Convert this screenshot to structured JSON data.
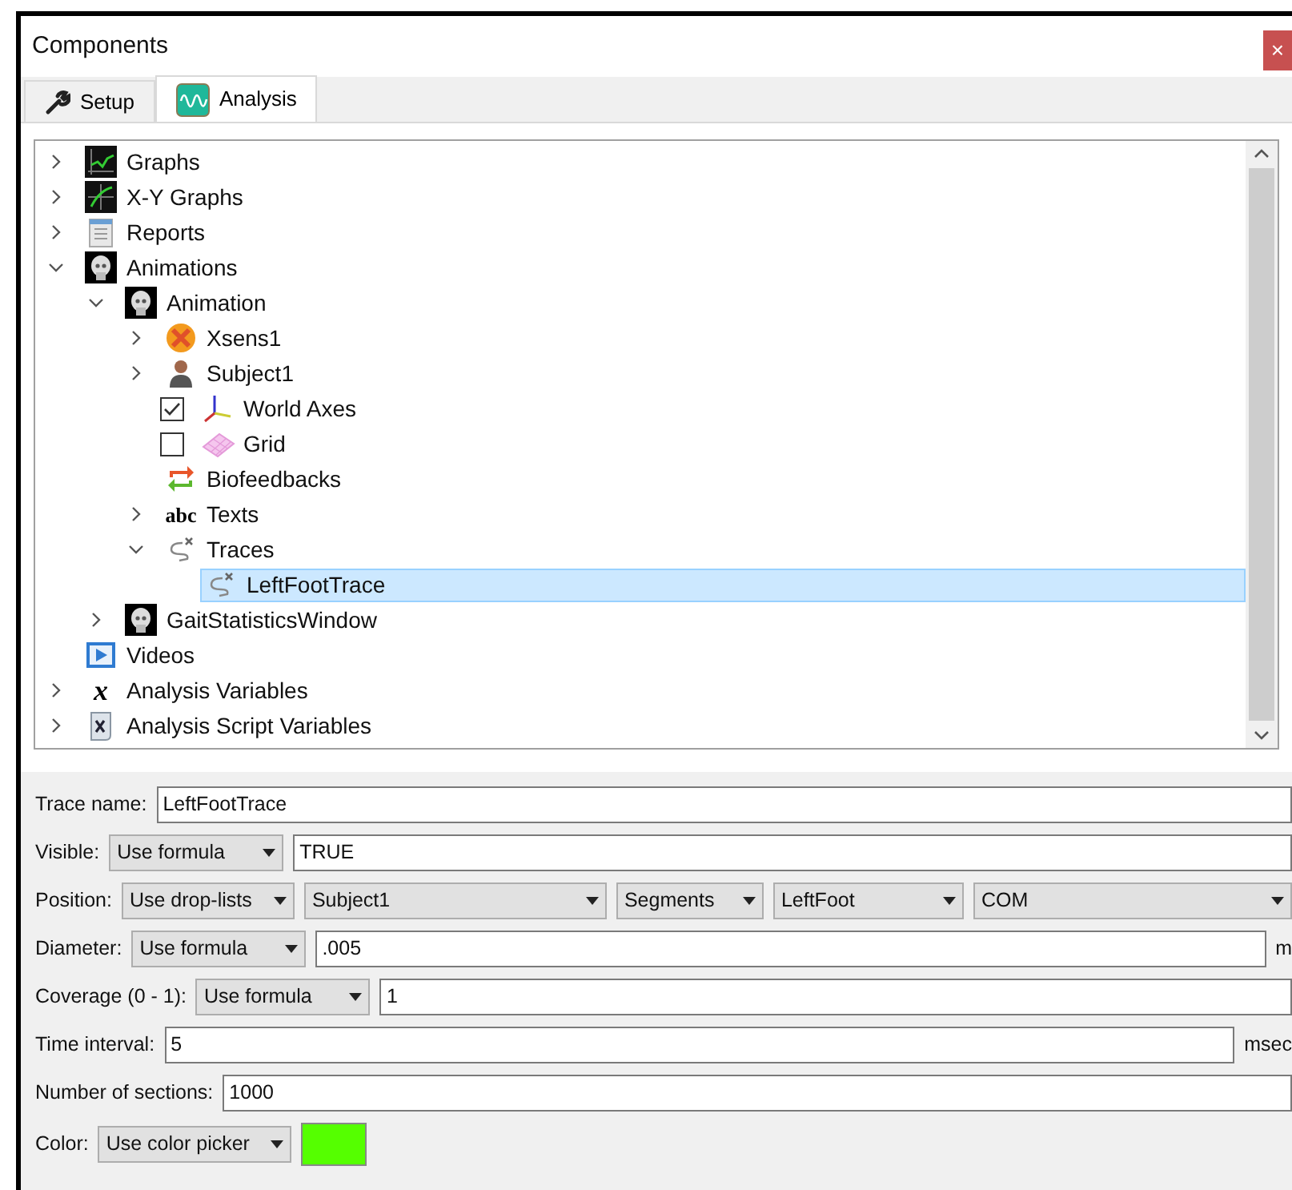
{
  "window": {
    "title": "Components",
    "close": "×"
  },
  "tabs": [
    {
      "label": "Setup",
      "selected": false
    },
    {
      "label": "Analysis",
      "selected": true
    }
  ],
  "tree": {
    "items": [
      {
        "label": "Graphs",
        "kind": "graph",
        "expanded": false,
        "selected": false
      },
      {
        "label": "X-Y Graphs",
        "kind": "xy-graph",
        "expanded": false,
        "selected": false
      },
      {
        "label": "Reports",
        "kind": "report",
        "expanded": false,
        "selected": false
      },
      {
        "label": "Animations",
        "kind": "skull",
        "expanded": true,
        "selected": false,
        "children": [
          {
            "label": "Animation",
            "kind": "skull",
            "expanded": true,
            "selected": false,
            "children": [
              {
                "label": "Xsens1",
                "kind": "xsens",
                "expanded": false,
                "selected": false
              },
              {
                "label": "Subject1",
                "kind": "person",
                "expanded": false,
                "selected": false
              },
              {
                "label": "World Axes",
                "kind": "axes",
                "checked": true,
                "selected": false
              },
              {
                "label": "Grid",
                "kind": "grid",
                "checked": false,
                "selected": false
              },
              {
                "label": "Biofeedbacks",
                "kind": "biofeedback",
                "selected": false
              },
              {
                "label": "Texts",
                "kind": "text",
                "icon_text": "abc",
                "expanded": false,
                "selected": false
              },
              {
                "label": "Traces",
                "kind": "trace",
                "expanded": true,
                "selected": false,
                "children": [
                  {
                    "label": "LeftFootTrace",
                    "kind": "trace",
                    "selected": true
                  }
                ]
              }
            ]
          },
          {
            "label": "GaitStatisticsWindow",
            "kind": "skull",
            "expanded": false,
            "selected": false
          }
        ]
      },
      {
        "label": "Videos",
        "kind": "video",
        "selected": false
      },
      {
        "label": "Analysis Variables",
        "kind": "variable",
        "icon_text": "x",
        "expanded": false,
        "selected": false
      },
      {
        "label": "Analysis Script Variables",
        "kind": "script",
        "expanded": false,
        "selected": false
      }
    ]
  },
  "form": {
    "rows": [
      {
        "label": "Trace name:",
        "controls": [
          {
            "kind": "input",
            "value": "LeftFootTrace"
          }
        ]
      },
      {
        "label": "Visible:",
        "controls": [
          {
            "kind": "dropdown",
            "value": "Use formula"
          },
          {
            "kind": "input",
            "value": "TRUE"
          }
        ]
      },
      {
        "label": "Position:",
        "controls": [
          {
            "kind": "dropdown",
            "value": "Use drop-lists"
          },
          {
            "kind": "dropdown",
            "value": "Subject1"
          },
          {
            "kind": "dropdown",
            "value": "Segments"
          },
          {
            "kind": "dropdown",
            "value": "LeftFoot"
          },
          {
            "kind": "dropdown",
            "value": "COM"
          }
        ]
      },
      {
        "label": "Diameter:",
        "controls": [
          {
            "kind": "dropdown",
            "value": "Use formula"
          },
          {
            "kind": "input",
            "value": ".005"
          },
          {
            "kind": "unit",
            "value": "m"
          }
        ]
      },
      {
        "label": "Coverage (0 - 1):",
        "controls": [
          {
            "kind": "dropdown",
            "value": "Use formula"
          },
          {
            "kind": "input",
            "value": "1"
          }
        ]
      },
      {
        "label": "Time interval:",
        "controls": [
          {
            "kind": "input",
            "value": "5"
          },
          {
            "kind": "unit",
            "value": "msec"
          }
        ]
      },
      {
        "label": "Number of sections:",
        "controls": [
          {
            "kind": "input",
            "value": "1000"
          }
        ]
      },
      {
        "label": "Color:",
        "controls": [
          {
            "kind": "dropdown",
            "value": "Use color picker"
          },
          {
            "kind": "swatch",
            "color": "#55ff00"
          }
        ]
      }
    ]
  }
}
